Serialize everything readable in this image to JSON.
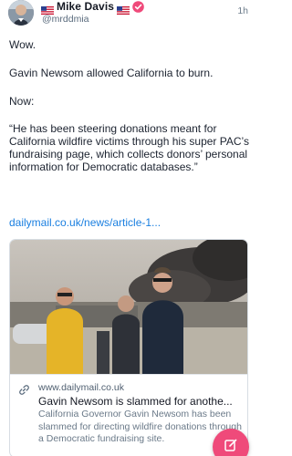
{
  "post": {
    "author": {
      "display_name": "Mike Davis",
      "handle": "@mrddmia",
      "flag_icon": "us-flag-icon",
      "verified_icon": "verified-badge-icon"
    },
    "time": "1h",
    "text_lines": [
      "Wow.",
      "Gavin Newsom allowed California to burn.",
      "Now:",
      "“He has been steering donations meant for California wildfire victims through his super PAC’s fundraising page, which collects donors’ personal information for Democratic databases.”"
    ],
    "link_text": "dailymail.co.uk/news/article-1..."
  },
  "link_card": {
    "domain": "www.dailymail.co.uk",
    "title": "Gavin Newsom is slammed for anothe...",
    "description": "California Governor Gavin Newsom has been slammed for directing wildfire donations through a Democratic fundraising site.",
    "link_icon": "chain-link-icon"
  },
  "fab": {
    "icon": "compose-icon",
    "color": "#ef4a7a"
  },
  "colors": {
    "link": "#1a7fe0",
    "verified": "#ef4a7a"
  }
}
